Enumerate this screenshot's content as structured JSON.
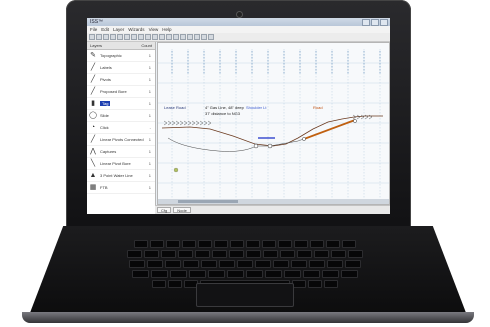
{
  "window": {
    "title": "ISS™"
  },
  "menu": [
    "File",
    "Edit",
    "Layer",
    "Wizards",
    "View",
    "Help"
  ],
  "panel": {
    "col_name": "Layers",
    "col_count": "Count"
  },
  "layers": [
    {
      "label": "Topographic",
      "count": "1",
      "icon": "✎",
      "selected": false
    },
    {
      "label": "Labels",
      "count": "1",
      "icon": "╱",
      "selected": false
    },
    {
      "label": "Pivots",
      "count": "1",
      "icon": "╱",
      "selected": false
    },
    {
      "label": "Proposed Bore",
      "count": "1",
      "icon": "╱",
      "selected": false
    },
    {
      "label": "Tag",
      "count": "1",
      "icon": "▮",
      "selected": true
    },
    {
      "label": "Slide",
      "count": "1",
      "icon": "◯",
      "selected": false
    },
    {
      "label": "Click",
      "count": "-",
      "icon": "◔",
      "selected": false
    },
    {
      "label": "Linear Pivots Connected",
      "count": "1",
      "icon": "╱",
      "selected": false
    },
    {
      "label": "Captures",
      "count": "1",
      "icon": "⋀",
      "selected": false
    },
    {
      "label": "Linear Pivot Bore",
      "count": "1",
      "icon": "╲",
      "selected": false
    },
    {
      "label": "3 Point Water Line",
      "count": "1",
      "icon": "▲",
      "selected": false
    },
    {
      "label": "FTB",
      "count": "1",
      "icon": "▦",
      "selected": false
    }
  ],
  "drawing": {
    "left_label": "Lease Road",
    "note_line1": "4\" Gas Line, 48\" deep",
    "note_line2": "37' distance to NG3",
    "center_label": "Shoulder Lt",
    "right_label": "Road"
  },
  "status_tabs": [
    "Cfg",
    "Node"
  ],
  "colors": {
    "selection": "#1d3fb0",
    "bore_line": "#c06010",
    "profile_line": "#6b3a1f",
    "grid": "#a8c4dc"
  }
}
